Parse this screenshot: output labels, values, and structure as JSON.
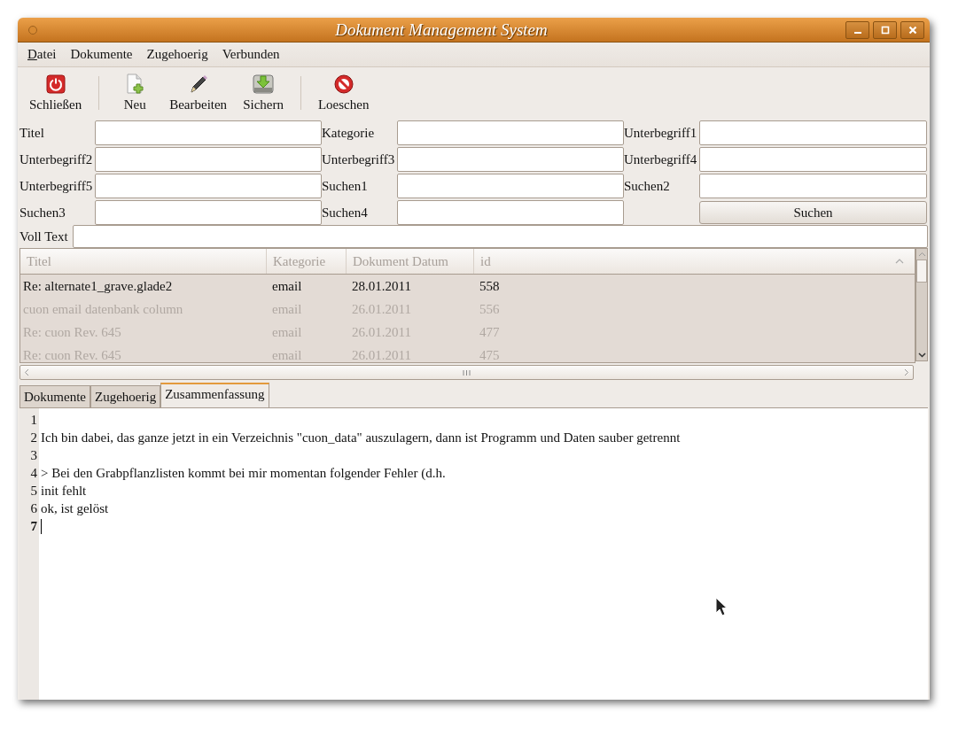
{
  "window": {
    "title": "Dokument Management System"
  },
  "menu": [
    {
      "label": "Datei",
      "mnemonic": true
    },
    {
      "label": "Dokumente",
      "mnemonic": false
    },
    {
      "label": "Zugehoerig",
      "mnemonic": false
    },
    {
      "label": "Verbunden",
      "mnemonic": false
    }
  ],
  "toolbar": [
    {
      "kind": "power",
      "label": "Schließen"
    },
    {
      "kind": "separator"
    },
    {
      "kind": "new",
      "label": "Neu"
    },
    {
      "kind": "edit",
      "label": "Bearbeiten"
    },
    {
      "kind": "save",
      "label": "Sichern"
    },
    {
      "kind": "separator"
    },
    {
      "kind": "delete",
      "label": "Loeschen"
    }
  ],
  "form": [
    {
      "kind": "field",
      "label": "Titel"
    },
    {
      "kind": "field",
      "label": "Kategorie"
    },
    {
      "kind": "field",
      "label": "Unterbegriff1"
    },
    {
      "kind": "field",
      "label": "Unterbegriff2"
    },
    {
      "kind": "field",
      "label": "Unterbegriff3"
    },
    {
      "kind": "field",
      "label": "Unterbegriff4"
    },
    {
      "kind": "field",
      "label": "Unterbegriff5"
    },
    {
      "kind": "field",
      "label": "Suchen1"
    },
    {
      "kind": "field",
      "label": "Suchen2"
    },
    {
      "kind": "field",
      "label": "Suchen3"
    },
    {
      "kind": "field",
      "label": "Suchen4"
    },
    {
      "kind": "button",
      "label": "Suchen"
    }
  ],
  "full_text": {
    "label": "Voll Text"
  },
  "table": {
    "columns": [
      {
        "label": "Titel",
        "sorted": false
      },
      {
        "label": "Kategorie",
        "sorted": false
      },
      {
        "label": "Dokument Datum",
        "sorted": false
      },
      {
        "label": "id",
        "sorted": true
      }
    ],
    "rows": [
      {
        "selected": true,
        "cells": [
          "Re: alternate1_grave.glade2",
          "email",
          "28.01.2011",
          "558"
        ]
      },
      {
        "selected": false,
        "cells": [
          "cuon email datenbank column",
          "email",
          "26.01.2011",
          "556"
        ]
      },
      {
        "selected": false,
        "cells": [
          "Re: cuon Rev. 645",
          "email",
          "26.01.2011",
          "477"
        ]
      },
      {
        "selected": false,
        "cells": [
          "Re: cuon Rev. 645",
          "email",
          "26.01.2011",
          "475"
        ]
      }
    ]
  },
  "tabs": [
    {
      "label": "Dokumente",
      "selected": false
    },
    {
      "label": "Zugehoerig",
      "selected": false
    },
    {
      "label": "Zusammenfassung",
      "selected": true
    }
  ],
  "editor": {
    "lines": [
      {
        "number": "1",
        "current": false
      },
      {
        "number": "2",
        "text": "Ich bin dabei, das ganze jetzt in ein Verzeichnis \"cuon_data\" auszulagern, dann ist Programm und Daten sauber getrennt",
        "current": false
      },
      {
        "number": "3",
        "current": false
      },
      {
        "number": "4",
        "text": "> Bei den Grabpflanzlisten kommt bei mir momentan folgender Fehler (d.h.",
        "current": false
      },
      {
        "number": "5",
        "text": "init fehlt",
        "current": false
      },
      {
        "number": "6",
        "text": "ok, ist gelöst",
        "current": false
      },
      {
        "number": "7",
        "current": true
      }
    ]
  }
}
